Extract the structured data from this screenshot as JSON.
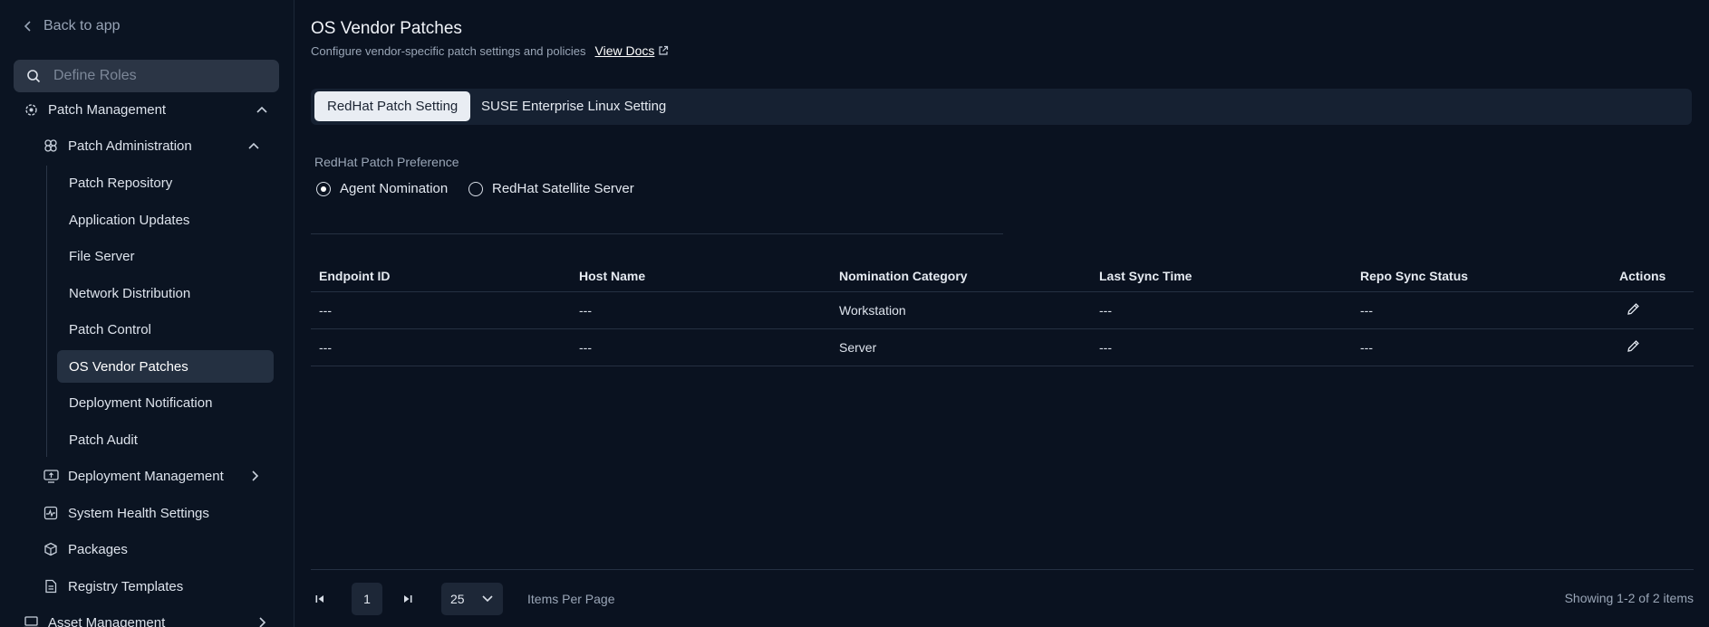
{
  "sidebar": {
    "back_label": "Back to app",
    "search_placeholder": "Define Roles",
    "patch_management": "Patch Management",
    "patch_administration": "Patch Administration",
    "sub_items": [
      "Patch Repository",
      "Application Updates",
      "File Server",
      "Network Distribution",
      "Patch Control",
      "OS Vendor Patches",
      "Deployment Notification",
      "Patch Audit"
    ],
    "deployment_management": "Deployment Management",
    "system_health": "System Health Settings",
    "packages": "Packages",
    "registry_templates": "Registry Templates",
    "asset_management": "Asset Management"
  },
  "header": {
    "title": "OS Vendor Patches",
    "subtitle": "Configure vendor-specific patch settings and policies",
    "docs_link": "View Docs"
  },
  "tabs": [
    "RedHat Patch Setting",
    "SUSE Enterprise Linux Setting"
  ],
  "preference": {
    "label": "RedHat Patch Preference",
    "options": [
      "Agent Nomination",
      "RedHat Satellite Server"
    ],
    "selected": "Agent Nomination"
  },
  "table": {
    "columns": [
      "Endpoint ID",
      "Host Name",
      "Nomination Category",
      "Last Sync Time",
      "Repo Sync Status",
      "Actions"
    ],
    "rows": [
      [
        "---",
        "---",
        "Workstation",
        "---",
        "---"
      ],
      [
        "---",
        "---",
        "Server",
        "---",
        "---"
      ]
    ]
  },
  "pagination": {
    "page": "1",
    "per_page": "25",
    "per_page_label": "Items Per Page",
    "showing": "Showing 1-2 of 2 items"
  },
  "colors": {
    "background": "#0a1220",
    "active_item": "#243041",
    "tab_active": "#e9edf3"
  }
}
